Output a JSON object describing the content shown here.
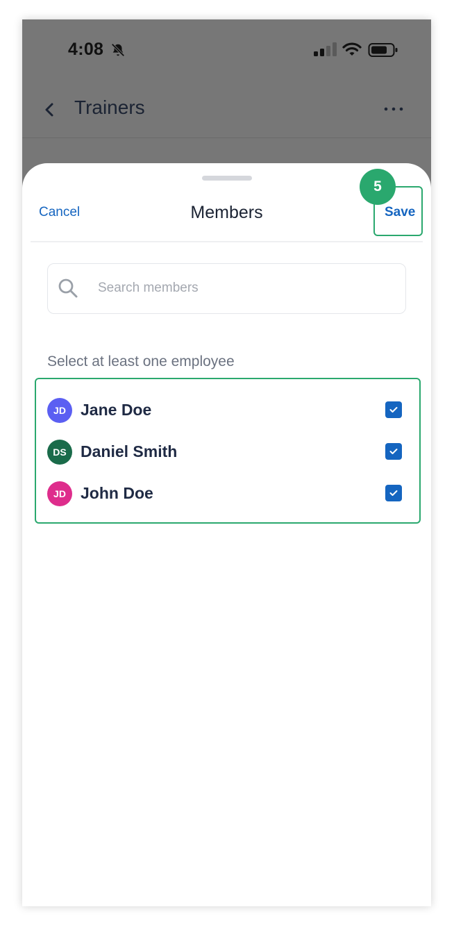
{
  "status_bar": {
    "time": "4:08",
    "icons": [
      "bell-off-icon",
      "signal-icon",
      "wifi-icon",
      "battery-icon"
    ]
  },
  "nav": {
    "title": "Trainers",
    "back_icon": "chevron-left-icon",
    "more_icon": "more-horizontal-icon"
  },
  "sheet": {
    "title": "Members",
    "cancel_label": "Cancel",
    "save_label": "Save",
    "step_badge": "5",
    "search": {
      "placeholder": "Search members",
      "value": ""
    },
    "hint": "Select at least one employee",
    "members": [
      {
        "initials": "JD",
        "name": "Jane Doe",
        "avatar_color": "#5b5ff2",
        "checked": true
      },
      {
        "initials": "DS",
        "name": "Daniel Smith",
        "avatar_color": "#1a6b4a",
        "checked": true
      },
      {
        "initials": "JD",
        "name": "John Doe",
        "avatar_color": "#de2d8c",
        "checked": true
      }
    ]
  },
  "colors": {
    "accent": "#1565c0",
    "highlight": "#2aa86e",
    "overlay": "#777777"
  }
}
